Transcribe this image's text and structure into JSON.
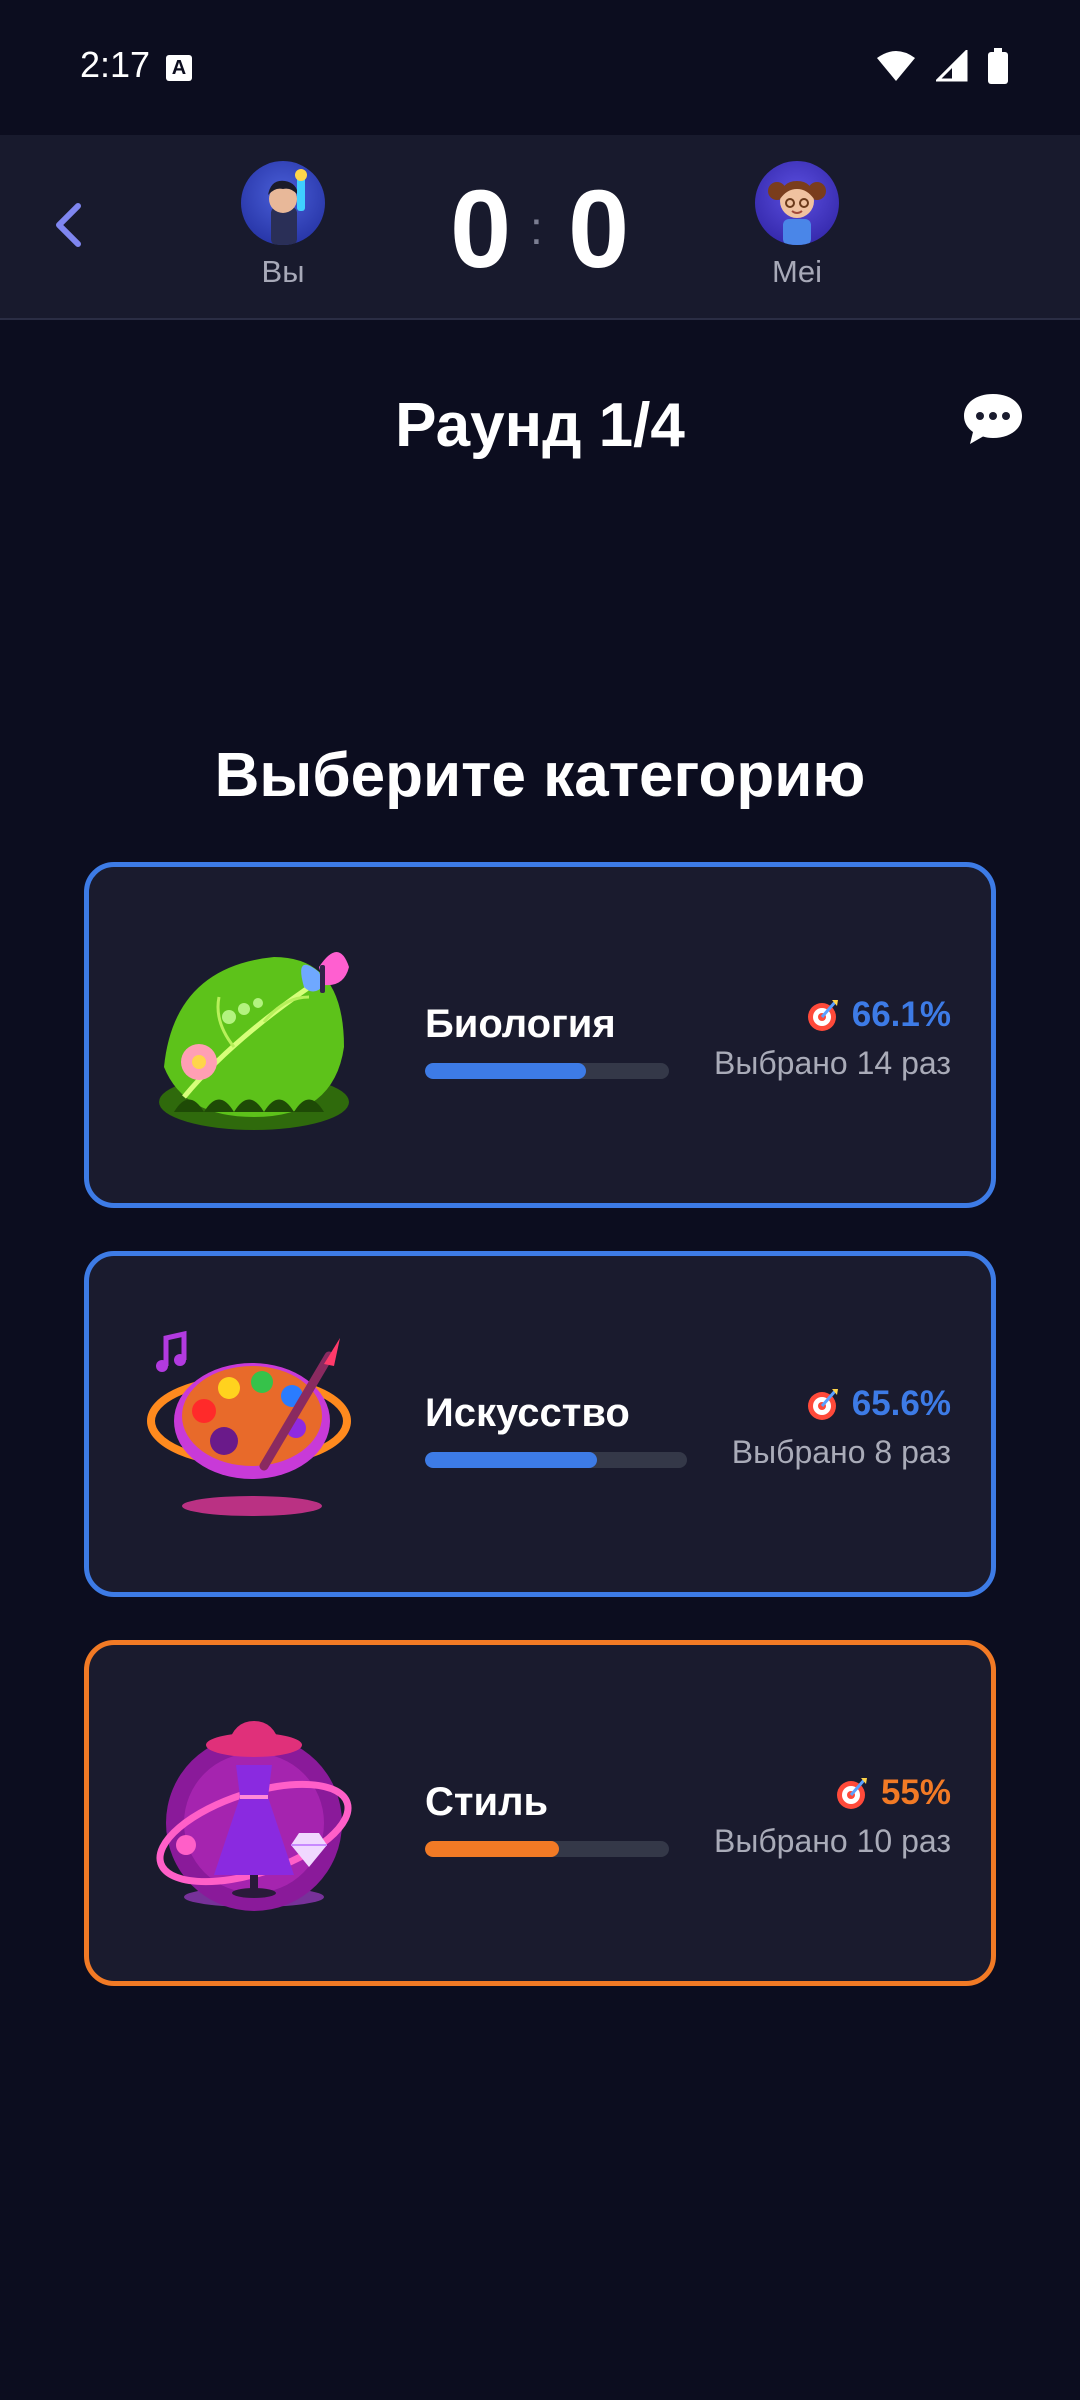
{
  "status_bar": {
    "time": "2:17",
    "notification_glyph": "A"
  },
  "header": {
    "player_you": {
      "name": "Вы",
      "score": "0"
    },
    "player_opponent": {
      "name": "Mei",
      "score": "0"
    },
    "score_separator": ":"
  },
  "round": {
    "title": "Раунд 1/4"
  },
  "main": {
    "title": "Выберите категорию"
  },
  "categories": [
    {
      "name": "Биология",
      "percent": "66.1%",
      "picked": "Выбрано 14 раз",
      "progress": 0.661,
      "accent": "#3d7be6"
    },
    {
      "name": "Искусство",
      "percent": "65.6%",
      "picked": "Выбрано 8 раз",
      "progress": 0.656,
      "accent": "#3d7be6"
    },
    {
      "name": "Стиль",
      "percent": "55%",
      "picked": "Выбрано 10 раз",
      "progress": 0.55,
      "accent": "#f27a25"
    }
  ],
  "colors": {
    "background": "#0c0d1f",
    "card": "#1a1b2e",
    "blue": "#3d7be6",
    "orange": "#f27a25"
  }
}
